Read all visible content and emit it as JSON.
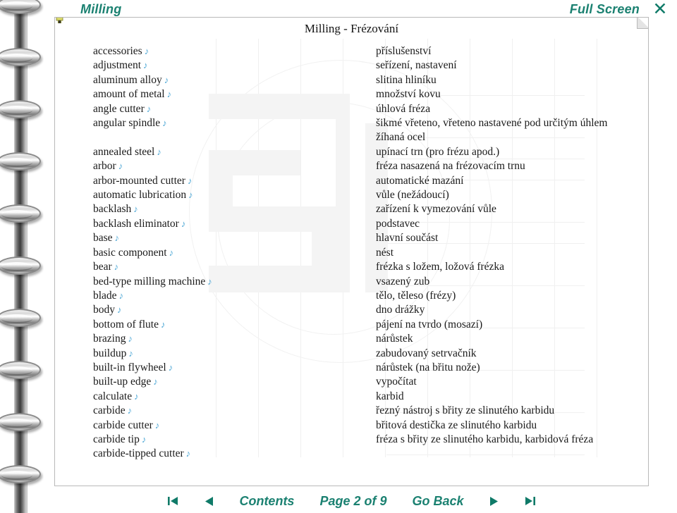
{
  "header": {
    "title_link": "Milling",
    "fullscreen_link": "Full Screen",
    "close_label": "✕"
  },
  "document": {
    "heading": "Milling - Frézování"
  },
  "icons": {
    "audio": "♪",
    "bookmark": "bookmark-icon",
    "first_page": "⏮",
    "prev_page": "◀",
    "next_page": "▶",
    "last_page": "⏭"
  },
  "colors": {
    "accent_teal": "#1b8171",
    "nav_teal": "#0f7a68",
    "audio_note": "#4fa8d6",
    "page_border": "#b9b9b9",
    "watermark": "#f0f0f0"
  },
  "glossary": {
    "english": [
      "accessories",
      "adjustment",
      "aluminum alloy",
      "amount of metal",
      "angle cutter",
      "angular spindle",
      "annealed steel",
      "arbor",
      "arbor-mounted cutter",
      "automatic lubrication",
      "backlash",
      "backlash eliminator",
      "base",
      "basic component",
      "bear",
      "bed-type milling machine",
      "blade",
      "body",
      "bottom of flute",
      "brazing",
      "buildup",
      "built-in flywheel",
      "built-up edge",
      "calculate",
      "carbide",
      "carbide cutter",
      "carbide tip",
      "carbide-tipped cutter"
    ],
    "czech": [
      "příslušenství",
      "seřízení, nastavení",
      "slitina hliníku",
      "množství kovu",
      "úhlová fréza",
      "šikmé vřeteno, vřeteno nastavené pod určitým úhlem",
      "žíhaná ocel",
      "upínací trn (pro frézu apod.)",
      "fréza nasazená na frézovacím trnu",
      "automatické mazání",
      "vůle (nežádoucí)",
      "zařízení k vymezování vůle",
      "podstavec",
      "hlavní součást",
      "nést",
      "frézka s ložem, ložová frézka",
      "vsazený zub",
      "tělo, těleso (frézy)",
      "dno drážky",
      "pájení na tvrdo (mosazí)",
      "nárůstek",
      "zabudovaný setrvačník",
      "nárůstek (na břitu nože)",
      "vypočítat",
      "karbid",
      "řezný nástroj s břity ze slinutého karbidu",
      "břitová destička ze slinutého karbidu",
      "fréza s břity ze slinutého karbidu, karbidová fréza"
    ]
  },
  "footer": {
    "contents_label": "Contents",
    "page_label": "Page 2 of 9",
    "goback_label": "Go Back"
  }
}
